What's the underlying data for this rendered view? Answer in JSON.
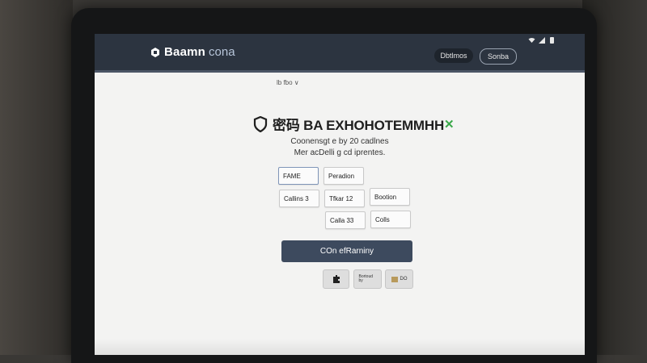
{
  "header": {
    "logo_text": "Baamn",
    "logo_accent": "cona",
    "button_primary": "Dbtlmos",
    "button_secondary": "Sonba",
    "status_icons": [
      "wifi-icon",
      "signal-icon",
      "battery-icon"
    ]
  },
  "language_selector": {
    "value": "lb fbo ∨"
  },
  "page": {
    "title": "密码 BA EXHOHOTEMMHH",
    "title_suffix": "✕",
    "subtitle_1": "Coonensgt e by 20 cadlnes",
    "subtitle_2": "Mer acDelli g cd iprentes."
  },
  "fields": {
    "f1": "FAME",
    "f2": "Peradion",
    "f3": "Callins 3",
    "f4": "Tfkar 12",
    "f5": "Bootion",
    "f6": "Calla 33",
    "f7": "Colls"
  },
  "primary_button": {
    "label": "COn efRarniny"
  },
  "secondary_buttons": {
    "b1_icon": "puzzle-icon",
    "b2_label": "Bortoud by",
    "b3_label": "DO"
  },
  "colors": {
    "header_bg": "#2c3440",
    "primary_button": "#3d4a5e",
    "accent_green": "#3aa84a"
  }
}
